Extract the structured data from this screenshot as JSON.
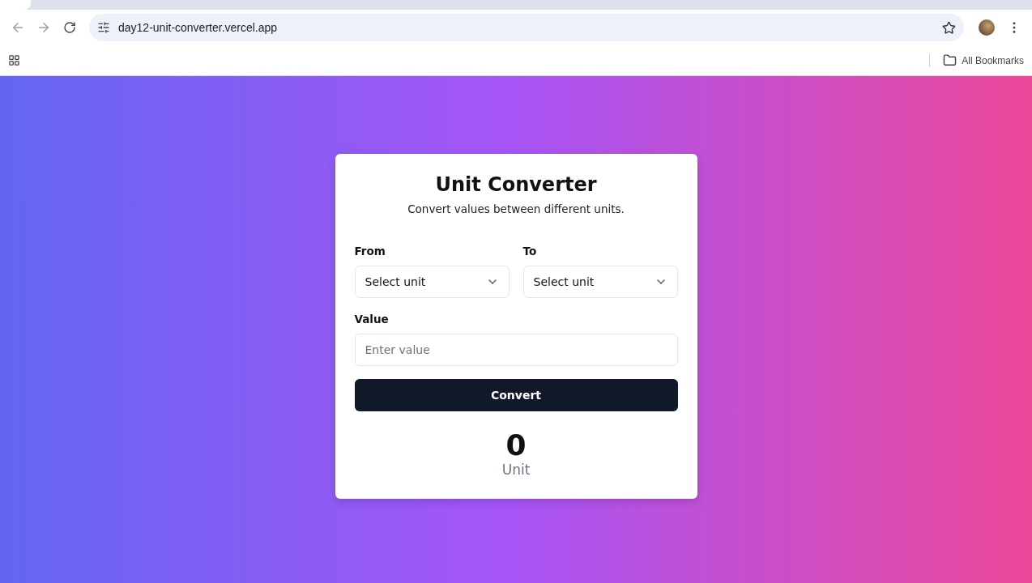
{
  "browser": {
    "url": "day12-unit-converter.vercel.app",
    "bookmarks_label": "All Bookmarks"
  },
  "converter": {
    "title": "Unit Converter",
    "subtitle": "Convert values between different units.",
    "selects": [
      {
        "label": "From",
        "value": "Select unit"
      },
      {
        "label": "To",
        "value": "Select unit"
      }
    ],
    "value_field": {
      "label": "Value",
      "placeholder": "Enter value"
    },
    "button": "Convert",
    "result": {
      "value": "0",
      "unit": "Unit"
    }
  }
}
